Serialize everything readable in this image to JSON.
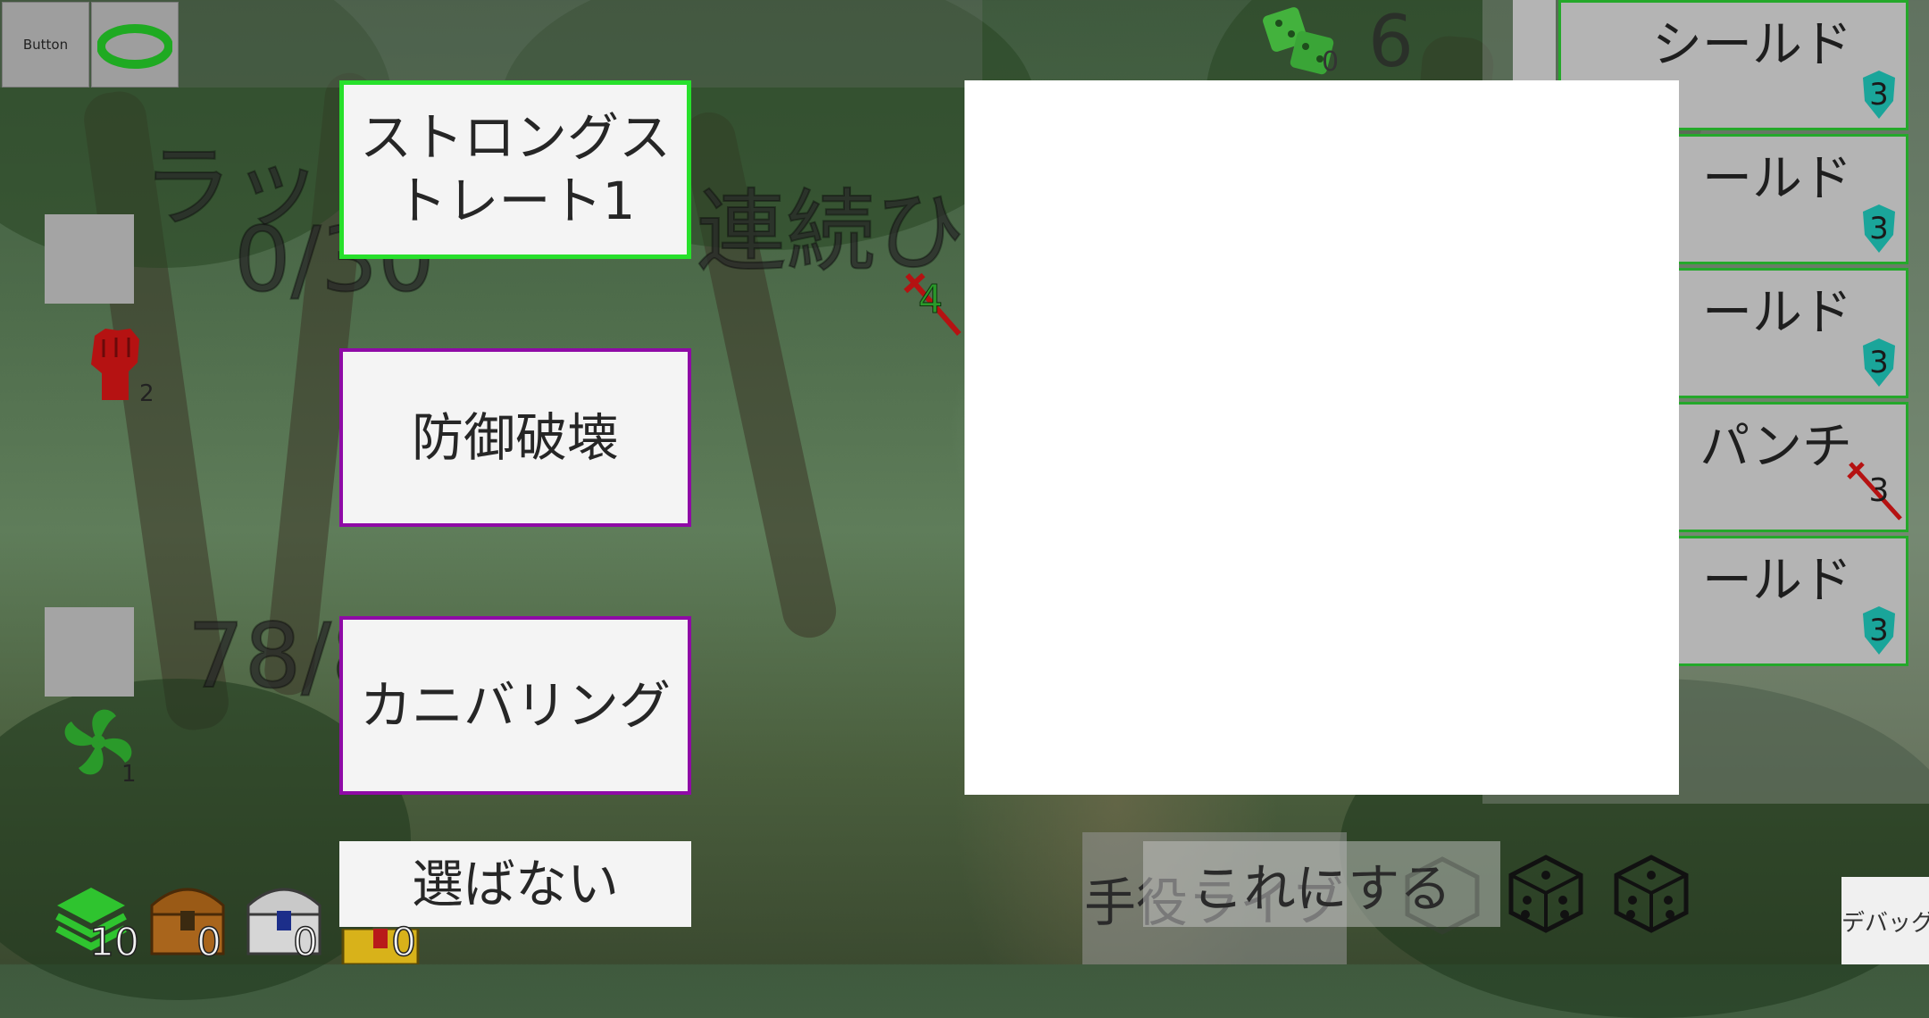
{
  "topbar": {
    "button_label": "Button",
    "dice_count": "6",
    "dice_sub": "0"
  },
  "enemy": {
    "name_partial": "ラッ",
    "hp": "0/30",
    "intent_text": "連続ひ",
    "attack_value": "4",
    "fist_count": "2"
  },
  "player": {
    "hp_partial": "78/8",
    "wind_count": "1"
  },
  "choices": {
    "option1": "ストロングス\nトレート1",
    "option2": "防御破壊",
    "option3": "カニバリング",
    "skip": "選ばない"
  },
  "cards": [
    {
      "label": "シールド",
      "value": "3",
      "type": "shield"
    },
    {
      "label": "ールド",
      "value": "3",
      "type": "shield"
    },
    {
      "label": "ールド",
      "value": "3",
      "type": "shield"
    },
    {
      "label": "パンチ",
      "value": "3",
      "type": "sword"
    },
    {
      "label": "ールド",
      "value": "3",
      "type": "shield"
    }
  ],
  "bottom": {
    "deck_count": "10",
    "chest1_count": "0",
    "chest2_count": "0",
    "chest3_count": "0",
    "hand_button": "手役ライブラリ",
    "decide_button": "これにする",
    "debug_button": "デバッグ"
  },
  "colors": {
    "accent_green": "#27e02b",
    "purple_border": "#8f0aa6",
    "enemy_red": "#b51212",
    "shield_teal": "#1aa59a"
  }
}
